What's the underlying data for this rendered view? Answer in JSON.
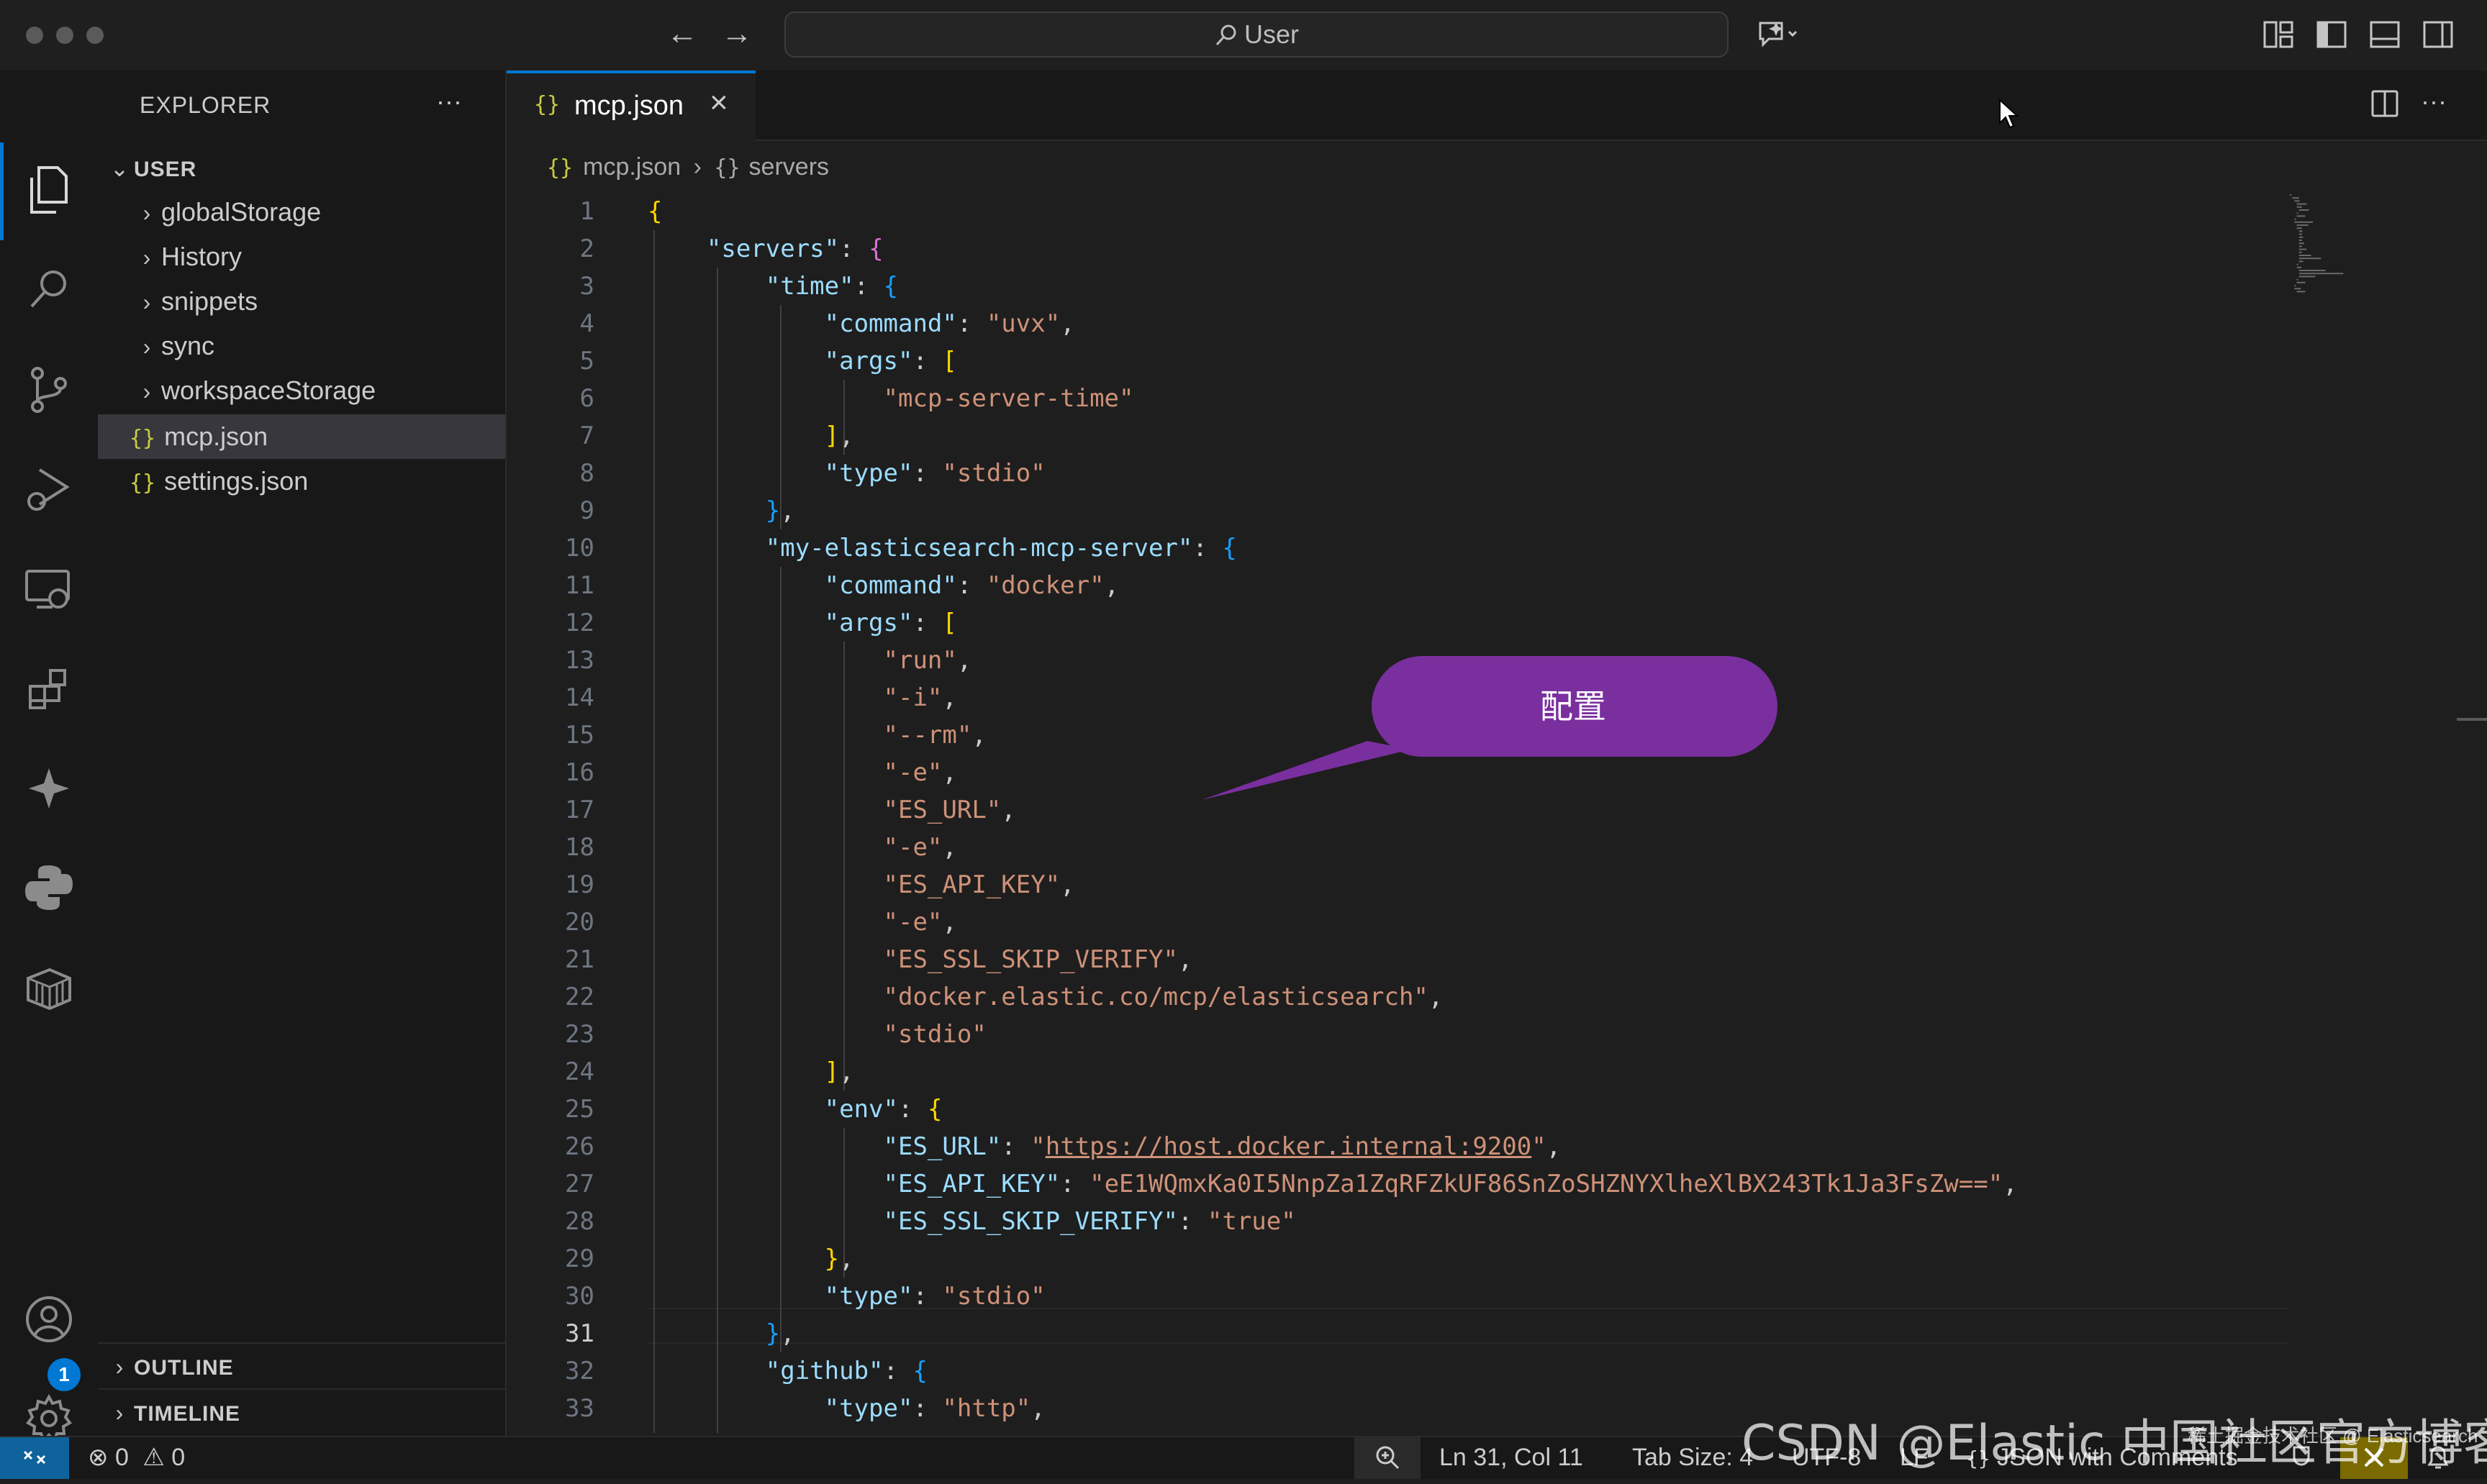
{
  "titlebar": {
    "search_text": "User"
  },
  "explorer": {
    "header": "EXPLORER",
    "more_label": "···",
    "section": "USER",
    "items": [
      {
        "label": "globalStorage",
        "kind": "folder"
      },
      {
        "label": "History",
        "kind": "folder"
      },
      {
        "label": "snippets",
        "kind": "folder"
      },
      {
        "label": "sync",
        "kind": "folder"
      },
      {
        "label": "workspaceStorage",
        "kind": "folder"
      },
      {
        "label": "mcp.json",
        "kind": "json",
        "selected": true
      },
      {
        "label": "settings.json",
        "kind": "json"
      }
    ],
    "outline": "OUTLINE",
    "timeline": "TIMELINE"
  },
  "activity_bar": {
    "icons": [
      "explorer-icon",
      "search-icon",
      "source-control-icon",
      "run-debug-icon",
      "remote-explorer-icon",
      "extensions-icon",
      "copilot-icon",
      "python-icon",
      "containers-icon",
      "accounts-icon",
      "settings-gear-icon"
    ],
    "accounts_badge": "1"
  },
  "editor": {
    "tab_icon": "{}",
    "tab_label": "mcp.json",
    "breadcrumb_file": "mcp.json",
    "breadcrumb_symbol": "servers",
    "breadcrumb_file_icon": "{}",
    "breadcrumb_symbol_icon": "{}",
    "current_line": 31,
    "line_numbers": [
      "1",
      "2",
      "3",
      "4",
      "5",
      "6",
      "7",
      "8",
      "9",
      "10",
      "11",
      "12",
      "13",
      "14",
      "15",
      "16",
      "17",
      "18",
      "19",
      "20",
      "21",
      "22",
      "23",
      "24",
      "25",
      "26",
      "27",
      "28",
      "29",
      "30",
      "31",
      "32",
      "33"
    ],
    "lines": [
      [
        [
          "b1",
          "{"
        ]
      ],
      [
        [
          "k",
          "    \"servers\""
        ],
        [
          "p",
          ": "
        ],
        [
          "b2",
          "{"
        ]
      ],
      [
        [
          "k",
          "        \"time\""
        ],
        [
          "p",
          ": "
        ],
        [
          "b3",
          "{"
        ]
      ],
      [
        [
          "k",
          "            \"command\""
        ],
        [
          "p",
          ": "
        ],
        [
          "s",
          "\"uvx\""
        ],
        [
          "p",
          ","
        ]
      ],
      [
        [
          "k",
          "            \"args\""
        ],
        [
          "p",
          ": "
        ],
        [
          "b1",
          "["
        ]
      ],
      [
        [
          "s",
          "                \"mcp-server-time\""
        ]
      ],
      [
        [
          "b1",
          "            ]"
        ],
        [
          "p",
          ","
        ]
      ],
      [
        [
          "k",
          "            \"type\""
        ],
        [
          "p",
          ": "
        ],
        [
          "s",
          "\"stdio\""
        ]
      ],
      [
        [
          "b3",
          "        }"
        ],
        [
          "p",
          ","
        ]
      ],
      [
        [
          "k",
          "        \"my-elasticsearch-mcp-server\""
        ],
        [
          "p",
          ": "
        ],
        [
          "b3",
          "{"
        ]
      ],
      [
        [
          "k",
          "            \"command\""
        ],
        [
          "p",
          ": "
        ],
        [
          "s",
          "\"docker\""
        ],
        [
          "p",
          ","
        ]
      ],
      [
        [
          "k",
          "            \"args\""
        ],
        [
          "p",
          ": "
        ],
        [
          "b1",
          "["
        ]
      ],
      [
        [
          "s",
          "                \"run\""
        ],
        [
          "p",
          ","
        ]
      ],
      [
        [
          "s",
          "                \"-i\""
        ],
        [
          "p",
          ","
        ]
      ],
      [
        [
          "s",
          "                \"--rm\""
        ],
        [
          "p",
          ","
        ]
      ],
      [
        [
          "s",
          "                \"-e\""
        ],
        [
          "p",
          ","
        ]
      ],
      [
        [
          "s",
          "                \"ES_URL\""
        ],
        [
          "p",
          ","
        ]
      ],
      [
        [
          "s",
          "                \"-e\""
        ],
        [
          "p",
          ","
        ]
      ],
      [
        [
          "s",
          "                \"ES_API_KEY\""
        ],
        [
          "p",
          ","
        ]
      ],
      [
        [
          "s",
          "                \"-e\""
        ],
        [
          "p",
          ","
        ]
      ],
      [
        [
          "s",
          "                \"ES_SSL_SKIP_VERIFY\""
        ],
        [
          "p",
          ","
        ]
      ],
      [
        [
          "s",
          "                \"docker.elastic.co/mcp/elasticsearch\""
        ],
        [
          "p",
          ","
        ]
      ],
      [
        [
          "s",
          "                \"stdio\""
        ]
      ],
      [
        [
          "b1",
          "            ]"
        ],
        [
          "p",
          ","
        ]
      ],
      [
        [
          "k",
          "            \"env\""
        ],
        [
          "p",
          ": "
        ],
        [
          "b1",
          "{"
        ]
      ],
      [
        [
          "k",
          "                \"ES_URL\""
        ],
        [
          "p",
          ": "
        ],
        [
          "s",
          "\""
        ],
        [
          "su",
          "https://host.docker.internal:9200"
        ],
        [
          "s",
          "\""
        ],
        [
          "p",
          ","
        ]
      ],
      [
        [
          "k",
          "                \"ES_API_KEY\""
        ],
        [
          "p",
          ": "
        ],
        [
          "s",
          "\"eE1WQmxKa0I5NnpZa1ZqRFZkUF86SnZoSHZNYXlheXlBX243Tk1Ja3FsZw==\""
        ],
        [
          "p",
          ","
        ]
      ],
      [
        [
          "k",
          "                \"ES_SSL_SKIP_VERIFY\""
        ],
        [
          "p",
          ": "
        ],
        [
          "s",
          "\"true\""
        ]
      ],
      [
        [
          "b1",
          "            }"
        ],
        [
          "p",
          ","
        ]
      ],
      [
        [
          "k",
          "            \"type\""
        ],
        [
          "p",
          ": "
        ],
        [
          "s",
          "\"stdio\""
        ]
      ],
      [
        [
          "b3",
          "        }"
        ],
        [
          "p",
          ","
        ]
      ],
      [
        [
          "k",
          "        \"github\""
        ],
        [
          "p",
          ": "
        ],
        [
          "b3",
          "{"
        ]
      ],
      [
        [
          "k",
          "            \"type\""
        ],
        [
          "p",
          ": "
        ],
        [
          "s",
          "\"http\""
        ],
        [
          "p",
          ","
        ]
      ]
    ]
  },
  "callout": {
    "text": "配置",
    "color": "#7a2f9e"
  },
  "statusbar": {
    "problems_errors": "0",
    "problems_warnings": "0",
    "position": "Ln 31, Col 11",
    "tab_size": "Tab Size: 4",
    "encoding": "UTF-8",
    "eol": "LF",
    "language_icon": "{}",
    "language": "JSON with Comments"
  },
  "watermark": {
    "main": "CSDN @Elastic 中国社区官方博客",
    "secondary": "稀土掘金技术社区 @ Elasticsearch"
  },
  "colors": {
    "accent": "#0078d4",
    "remote_button": "#0e639c",
    "copilot_status": "#7a6a00"
  }
}
